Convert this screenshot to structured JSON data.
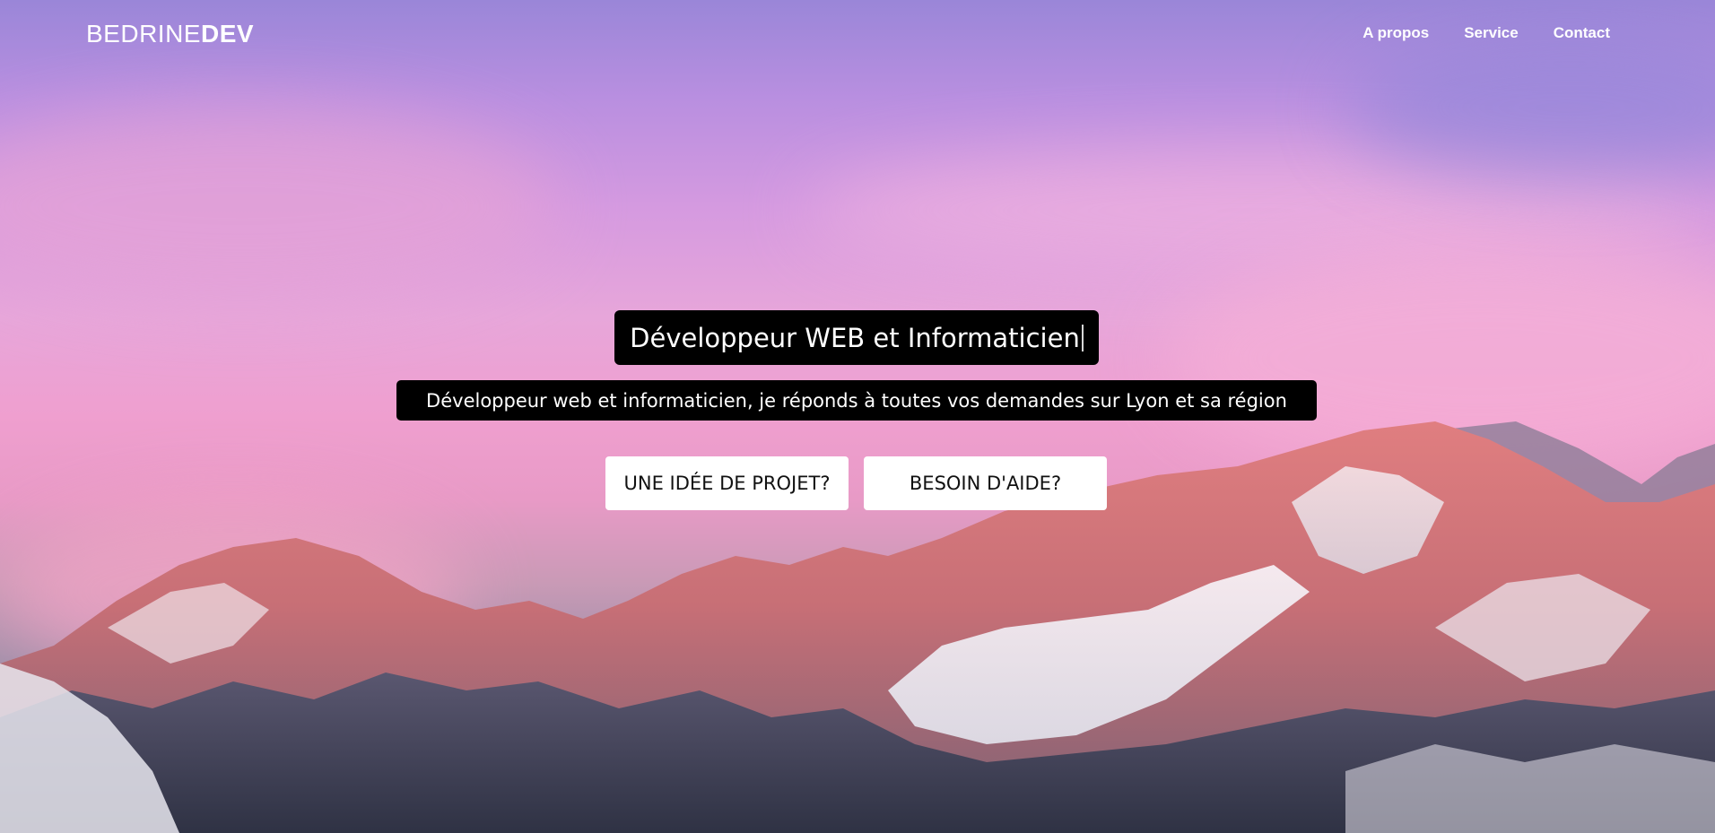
{
  "nav": {
    "brand_light": "BEDRINE",
    "brand_bold": "DEV",
    "links": [
      {
        "label": "A propos"
      },
      {
        "label": "Service"
      },
      {
        "label": "Contact"
      }
    ]
  },
  "hero": {
    "title": "Développeur WEB et Informaticien",
    "subtitle": "Développeur web et informaticien, je réponds à toutes vos demandes sur Lyon et sa région",
    "buttons": {
      "project": "UNE IDÉE DE PROJET?",
      "help": "BESOIN D'AIDE?"
    }
  },
  "colors": {
    "sky_top": "#9a86d8",
    "sky_pink": "#ef9fcf",
    "mountain_rock": "#c96a6e",
    "snow": "#f1eef2",
    "forest": "#3b3e52"
  }
}
